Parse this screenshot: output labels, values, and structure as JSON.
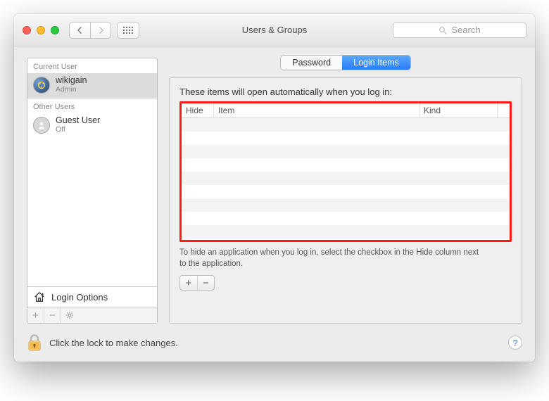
{
  "window_title": "Users & Groups",
  "search": {
    "placeholder": "Search"
  },
  "sidebar": {
    "current_label": "Current User",
    "other_label": "Other Users",
    "current_user": {
      "name": "wikigain",
      "role": "Admin"
    },
    "other_user": {
      "name": "Guest User",
      "role": "Off"
    },
    "login_options": "Login Options"
  },
  "tabs": {
    "password": "Password",
    "login_items": "Login Items"
  },
  "main": {
    "intro": "These items will open automatically when you log in:",
    "col_hide": "Hide",
    "col_item": "Item",
    "col_kind": "Kind",
    "hide_hint": "To hide an application when you log in, select the checkbox in the Hide column next to the application."
  },
  "footer": {
    "lock_text": "Click the lock to make changes.",
    "help": "?"
  },
  "glyphs": {
    "plus": "+",
    "minus": "−",
    "gear": "✱"
  }
}
